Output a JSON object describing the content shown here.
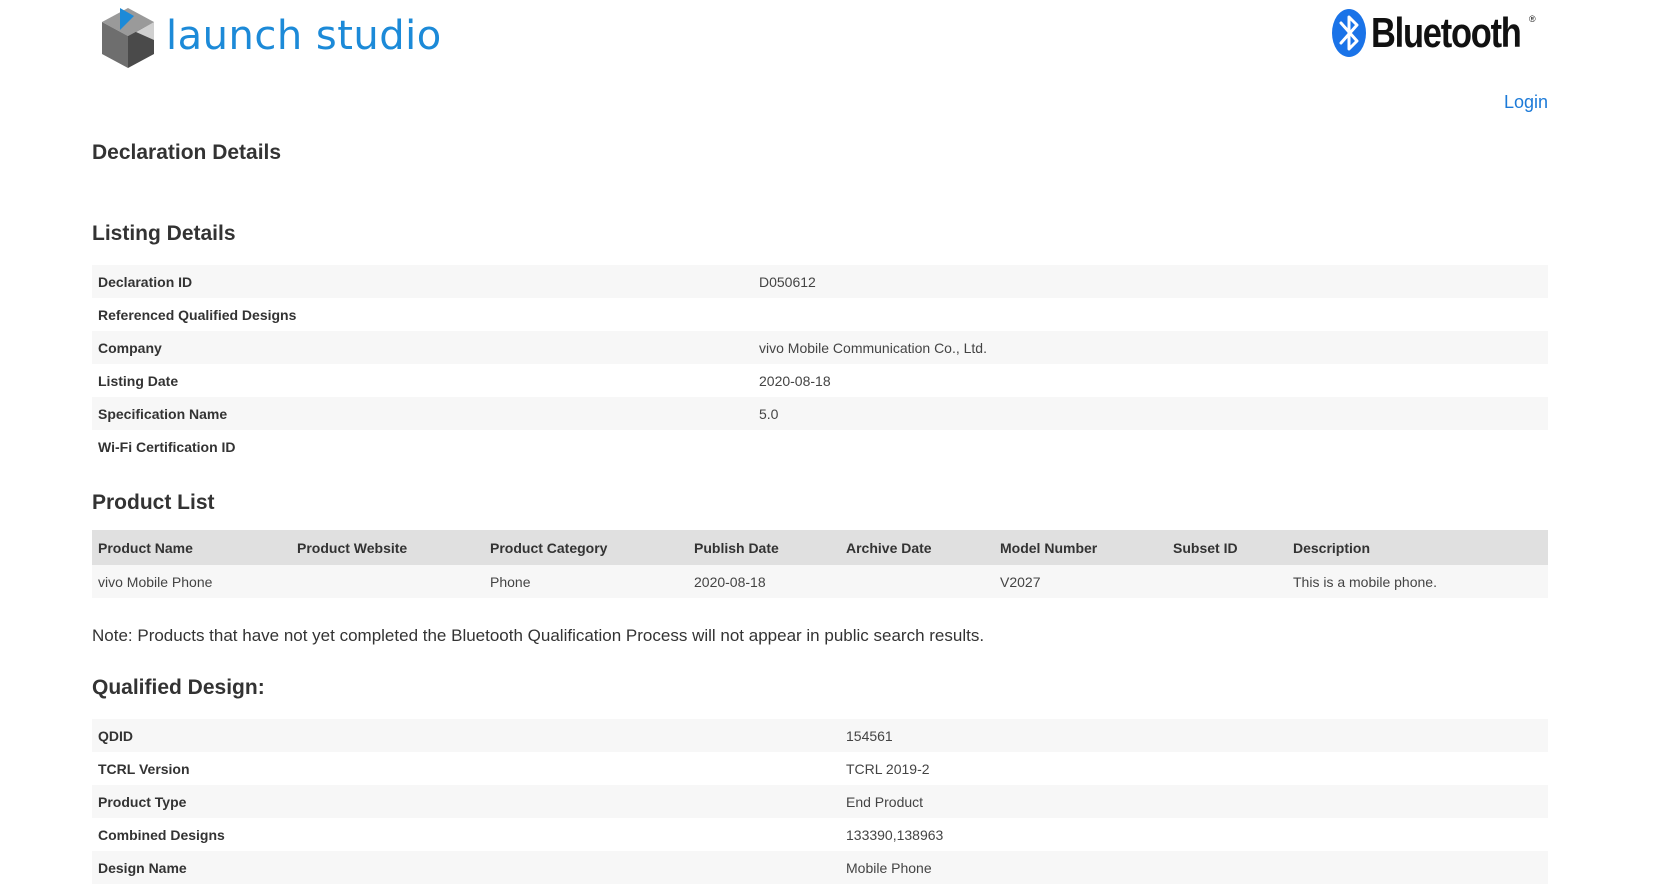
{
  "header": {
    "brand": "launch studio",
    "partner_logo": "Bluetooth",
    "partner_logo_mark": "®",
    "login_label": "Login"
  },
  "page_title": "Declaration Details",
  "listing": {
    "title": "Listing Details",
    "rows": [
      {
        "label": "Declaration ID",
        "value": "D050612"
      },
      {
        "label": "Referenced Qualified Designs",
        "value": ""
      },
      {
        "label": "Company",
        "value": "vivo Mobile Communication Co., Ltd."
      },
      {
        "label": "Listing Date",
        "value": "2020-08-18"
      },
      {
        "label": "Specification Name",
        "value": "5.0"
      },
      {
        "label": "Wi-Fi Certification ID",
        "value": ""
      }
    ]
  },
  "product_list": {
    "title": "Product List",
    "columns": [
      "Product Name",
      "Product Website",
      "Product Category",
      "Publish Date",
      "Archive Date",
      "Model Number",
      "Subset ID",
      "Description"
    ],
    "rows": [
      [
        "vivo Mobile Phone",
        "",
        "Phone",
        "2020-08-18",
        "",
        "V2027",
        "",
        "This is a mobile phone."
      ]
    ]
  },
  "note": "Note: Products that have not yet completed the Bluetooth Qualification Process will not appear in public search results.",
  "qualified_design": {
    "title": "Qualified Design:",
    "rows": [
      {
        "label": "QDID",
        "value": "154561"
      },
      {
        "label": "TCRL Version",
        "value": "TCRL 2019-2"
      },
      {
        "label": "Product Type",
        "value": "End Product"
      },
      {
        "label": "Combined Designs",
        "value": "133390,138963"
      },
      {
        "label": "Design Name",
        "value": "Mobile Phone"
      }
    ]
  },
  "colors": {
    "brand_blue": "#1c8ad8",
    "link_blue": "#1c7ad8",
    "bluetooth_blue": "#1a73e8",
    "row_alt": "#f7f7f7",
    "header_gray": "#e0e0e0"
  }
}
